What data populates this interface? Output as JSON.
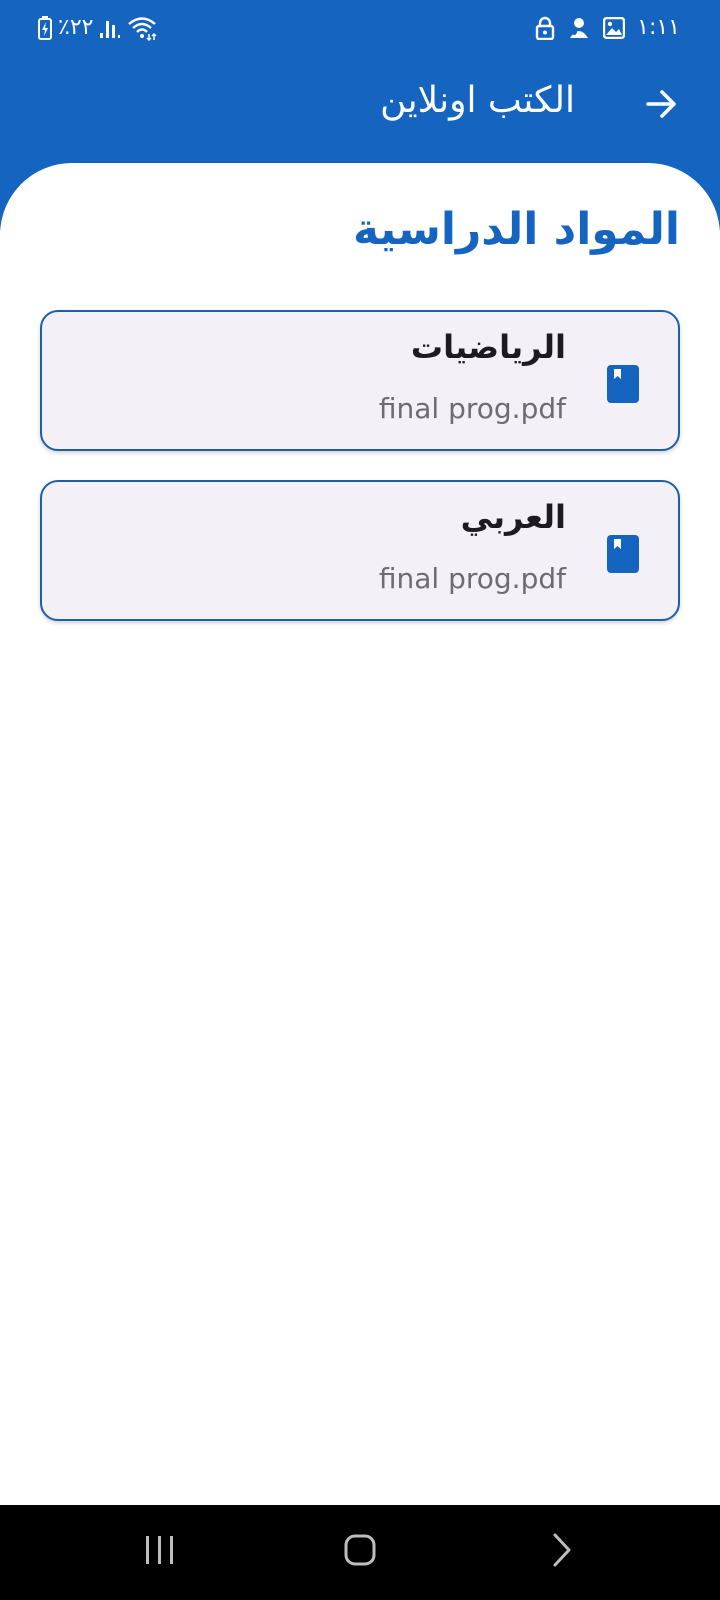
{
  "status_bar": {
    "time": "١:١١",
    "battery": "٪٢٢",
    "icons": [
      "lock-icon",
      "face-icon",
      "gallery-icon",
      "wifi-icon",
      "signal-icon",
      "battery-charging-icon"
    ]
  },
  "app_bar": {
    "title": "الكتب اونلاين",
    "back_icon": "arrow-right-icon"
  },
  "main": {
    "section_title": "المواد الدراسية",
    "items": [
      {
        "title": "الرياضيات",
        "subtitle": "final prog.pdf",
        "icon": "book-icon"
      },
      {
        "title": "العربي",
        "subtitle": "final prog.pdf",
        "icon": "book-icon"
      }
    ]
  },
  "navigation": {
    "buttons": [
      "recent-apps-icon",
      "home-icon",
      "back-icon"
    ]
  },
  "colors": {
    "primary": "#1565c0",
    "card_bg": "#f4f0f8",
    "card_border": "#1d5fa8",
    "nav_bg": "#000000"
  }
}
